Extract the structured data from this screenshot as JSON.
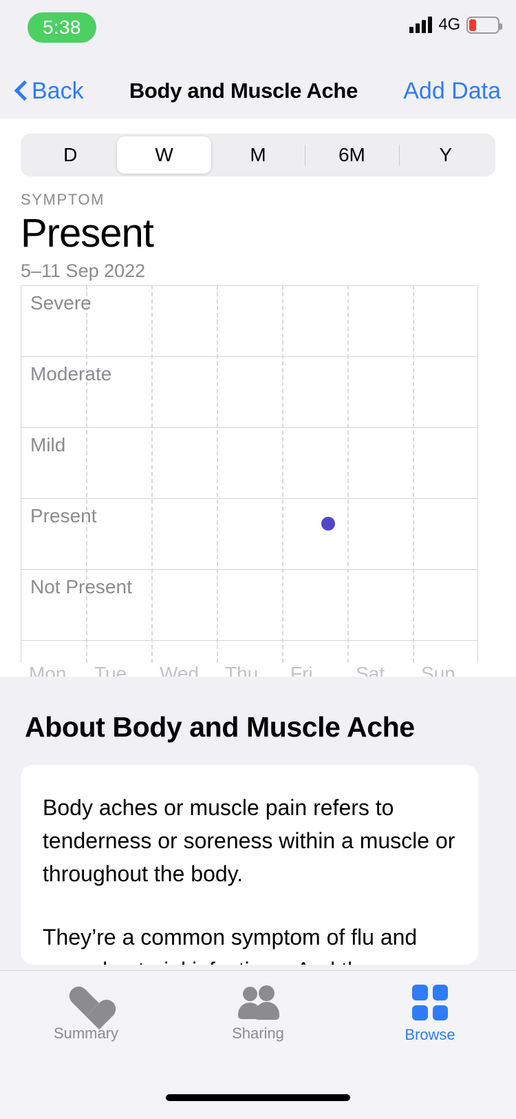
{
  "status_bar": {
    "time": "5:38",
    "network_label": "4G",
    "signal_bars": 4,
    "battery_level_pct": 26,
    "battery_color": "#ef3b2d",
    "recording_pill_color": "#4cd062"
  },
  "nav_bar": {
    "back_label": "Back",
    "title": "Body and Muscle Ache",
    "action_label": "Add Data",
    "accent_color": "#2f7cf6"
  },
  "segmented_control": {
    "options": [
      "D",
      "W",
      "M",
      "6M",
      "Y"
    ],
    "selected": "W"
  },
  "chart_header": {
    "kicker": "SYMPTOM",
    "title": "Present",
    "date_range": "5–11 Sep 2022"
  },
  "chart_data": {
    "type": "scatter",
    "title": "Present",
    "subtitle": "5–11 Sep 2022",
    "xlabel": "",
    "ylabel": "",
    "categories": [
      "Mon",
      "Tue",
      "Wed",
      "Thu",
      "Fri",
      "Sat",
      "Sun"
    ],
    "y_levels": [
      "Severe",
      "Moderate",
      "Mild",
      "Present",
      "Not Present"
    ],
    "grid": true,
    "legend": "none",
    "point_color": "#5146c8",
    "points": [
      {
        "x": "Fri",
        "y": "Present"
      }
    ],
    "series": [
      {
        "name": "Body and Muscle Ache",
        "values": [
          null,
          null,
          null,
          null,
          "Present",
          null,
          null
        ]
      }
    ]
  },
  "about": {
    "heading": "About Body and Muscle Ache",
    "paragraphs": [
      "Body aches or muscle pain refers to tenderness or soreness within a muscle or throughout the body.",
      "They’re a common symptom of flu and some bacterial infections. And they"
    ]
  },
  "tab_bar": {
    "tabs": [
      {
        "label": "Summary",
        "icon": "heart-icon",
        "active": false
      },
      {
        "label": "Sharing",
        "icon": "people-icon",
        "active": false
      },
      {
        "label": "Browse",
        "icon": "grid-icon",
        "active": true
      }
    ],
    "active_color": "#2f7cf6",
    "inactive_color": "#8b8b90"
  }
}
